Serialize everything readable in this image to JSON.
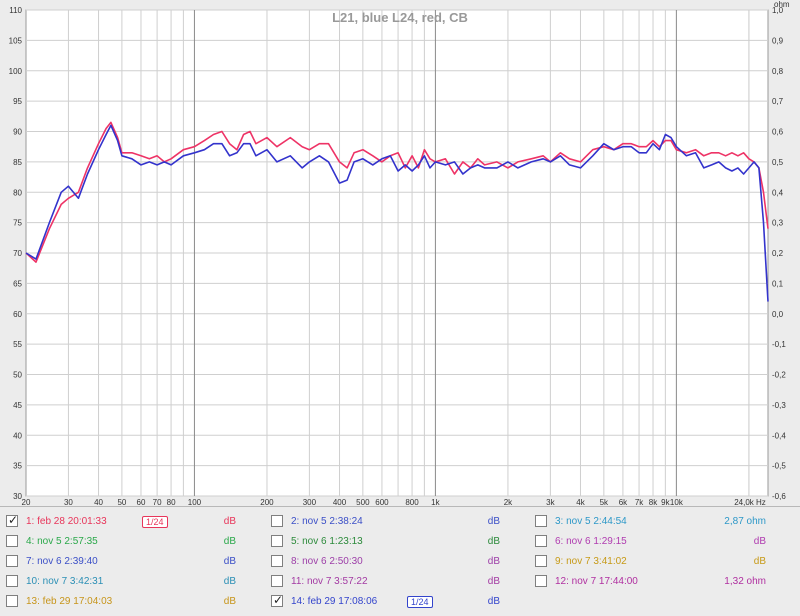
{
  "chart_data": {
    "type": "line",
    "title": "L21, blue L24, red, CB",
    "x_scale": "log",
    "xlim": [
      20,
      24000
    ],
    "ylim": [
      30,
      110
    ],
    "y2lim": [
      -0.6,
      1.0
    ],
    "y2_unit": "ohm",
    "grid": true,
    "y_ticks": [
      30,
      35,
      40,
      45,
      50,
      55,
      60,
      65,
      70,
      75,
      80,
      85,
      90,
      95,
      100,
      105,
      110
    ],
    "y2_ticks": [
      "-0,6",
      "-0,5",
      "-0,4",
      "-0,3",
      "-0,2",
      "-0,1",
      "0,0",
      "0,1",
      "0,2",
      "0,3",
      "0,4",
      "0,5",
      "0,6",
      "0,7",
      "0,8",
      "0,9",
      "1,0"
    ],
    "x_ticks": [
      {
        "v": 20,
        "l": "20"
      },
      {
        "v": 30,
        "l": "30"
      },
      {
        "v": 40,
        "l": "40"
      },
      {
        "v": 50,
        "l": "50"
      },
      {
        "v": 60,
        "l": "60"
      },
      {
        "v": 70,
        "l": "70"
      },
      {
        "v": 80,
        "l": "80"
      },
      {
        "v": 100,
        "l": "100"
      },
      {
        "v": 200,
        "l": "200"
      },
      {
        "v": 300,
        "l": "300"
      },
      {
        "v": 400,
        "l": "400"
      },
      {
        "v": 500,
        "l": "500"
      },
      {
        "v": 600,
        "l": "600"
      },
      {
        "v": 800,
        "l": "800"
      },
      {
        "v": 1000,
        "l": "1k"
      },
      {
        "v": 2000,
        "l": "2k"
      },
      {
        "v": 3000,
        "l": "3k"
      },
      {
        "v": 4000,
        "l": "4k"
      },
      {
        "v": 5000,
        "l": "5k"
      },
      {
        "v": 6000,
        "l": "6k"
      },
      {
        "v": 7000,
        "l": "7k"
      },
      {
        "v": 8000,
        "l": "8k"
      },
      {
        "v": 9000,
        "l": "9k"
      },
      {
        "v": 10000,
        "l": "10k"
      },
      {
        "v": 24000,
        "l": "24,0k Hz"
      }
    ],
    "series": [
      {
        "color": "#ee3366",
        "x": [
          20,
          22,
          25,
          28,
          30,
          33,
          36,
          40,
          43,
          45,
          48,
          50,
          55,
          60,
          65,
          70,
          75,
          80,
          90,
          100,
          110,
          120,
          130,
          140,
          150,
          160,
          170,
          180,
          200,
          220,
          250,
          280,
          300,
          330,
          360,
          400,
          430,
          460,
          500,
          550,
          600,
          650,
          700,
          750,
          800,
          850,
          900,
          950,
          1000,
          1100,
          1200,
          1300,
          1400,
          1500,
          1600,
          1800,
          2000,
          2200,
          2500,
          2800,
          3000,
          3300,
          3600,
          4000,
          4500,
          5000,
          5500,
          6000,
          6500,
          7000,
          7500,
          8000,
          8500,
          9000,
          9500,
          10000,
          11000,
          12000,
          13000,
          14000,
          15000,
          16000,
          17000,
          18000,
          19000,
          20000,
          21000,
          22000,
          23000,
          24000
        ],
        "y": [
          70,
          68.5,
          74,
          78,
          79,
          80,
          84,
          88,
          90.5,
          91.5,
          89,
          86.5,
          86.5,
          86,
          85.5,
          86,
          85,
          85.5,
          87,
          87.5,
          88.5,
          89.5,
          90,
          88,
          87,
          89.5,
          90,
          88,
          89,
          87.5,
          89,
          87.5,
          87,
          88,
          88,
          85,
          84,
          86.5,
          87,
          86,
          85,
          86,
          86.5,
          84,
          86,
          84,
          87,
          85.5,
          85,
          85.5,
          83,
          85,
          84,
          85.5,
          84.5,
          85,
          84,
          85,
          85.5,
          86,
          85,
          86.5,
          85.5,
          85,
          87,
          87.5,
          87,
          88,
          88,
          87.5,
          87.5,
          88.5,
          87.5,
          88.5,
          88.5,
          87,
          86.5,
          87,
          86,
          86.5,
          86.5,
          86,
          86.5,
          86,
          86.5,
          85.5,
          85,
          84,
          80,
          74
        ]
      },
      {
        "color": "#3333cc",
        "x": [
          20,
          22,
          25,
          28,
          30,
          33,
          36,
          40,
          43,
          45,
          48,
          50,
          55,
          60,
          65,
          70,
          75,
          80,
          90,
          100,
          110,
          120,
          130,
          140,
          150,
          160,
          170,
          180,
          200,
          220,
          250,
          280,
          300,
          330,
          360,
          400,
          430,
          460,
          500,
          550,
          600,
          650,
          700,
          750,
          800,
          850,
          900,
          950,
          1000,
          1100,
          1200,
          1300,
          1400,
          1500,
          1600,
          1800,
          2000,
          2200,
          2500,
          2800,
          3000,
          3300,
          3600,
          4000,
          4500,
          5000,
          5500,
          6000,
          6500,
          7000,
          7500,
          8000,
          8500,
          9000,
          9500,
          10000,
          11000,
          12000,
          13000,
          14000,
          15000,
          16000,
          17000,
          18000,
          19000,
          20000,
          21000,
          22000,
          23000,
          24000
        ],
        "y": [
          70,
          69,
          75,
          80,
          81,
          79,
          83,
          87,
          89.5,
          91,
          88.5,
          86,
          85.5,
          84.5,
          85,
          84.5,
          85,
          84.5,
          86,
          86.5,
          87,
          88,
          88,
          86,
          86.5,
          88,
          88,
          86,
          87,
          85,
          86,
          84,
          85,
          86,
          85,
          81.5,
          82,
          85,
          85.5,
          84.5,
          85.5,
          86,
          83.5,
          84.5,
          83.5,
          84.5,
          86,
          84,
          85,
          84.5,
          85,
          83,
          84,
          84.5,
          84,
          84,
          85,
          84,
          85,
          85.5,
          85,
          86,
          84.5,
          84,
          86,
          88,
          87,
          87.5,
          87.5,
          86.5,
          86.5,
          88,
          87,
          89.5,
          89,
          87.5,
          86,
          86.5,
          84,
          84.5,
          85,
          84,
          83.5,
          84,
          83,
          84,
          85,
          84,
          75,
          62
        ]
      }
    ],
    "legend": [
      {
        "label": "1: feb 28 20:01:33",
        "unit": "dB",
        "checked": true,
        "color": "#e8355a",
        "smoothing": "1/24"
      },
      {
        "label": "2: nov 5 2:38:24",
        "unit": "dB",
        "checked": false,
        "color": "#3b4fc7"
      },
      {
        "label": "3: nov 5 2:44:54",
        "unit": "2,87 ohm",
        "checked": false,
        "color": "#2d98c8"
      },
      {
        "label": "4: nov 5 2:57:35",
        "unit": "dB",
        "checked": false,
        "color": "#2aa84a"
      },
      {
        "label": "5: nov 6 1:23:13",
        "unit": "dB",
        "checked": false,
        "color": "#2b8a3a"
      },
      {
        "label": "6: nov 6 1:29:15",
        "unit": "dB",
        "checked": false,
        "color": "#b03cb0"
      },
      {
        "label": "7: nov 6 2:39:40",
        "unit": "dB",
        "checked": false,
        "color": "#3b4fc7"
      },
      {
        "label": "8: nov 6 2:50:30",
        "unit": "dB",
        "checked": false,
        "color": "#9d3ea8"
      },
      {
        "label": "9: nov 7 3:41:02",
        "unit": "dB",
        "checked": false,
        "color": "#c79a17"
      },
      {
        "label": "10: nov 7 3:42:31",
        "unit": "dB",
        "checked": false,
        "color": "#2b8fb5"
      },
      {
        "label": "11: nov 7 3:57:22",
        "unit": "dB",
        "checked": false,
        "color": "#a33aa3"
      },
      {
        "label": "12: nov 7 17:44:00",
        "unit": "1,32 ohm",
        "checked": false,
        "color": "#b02fa0"
      },
      {
        "label": "13: feb 29 17:04:03",
        "unit": "dB",
        "checked": false,
        "color": "#c7951a"
      },
      {
        "label": "14: feb 29 17:08:06",
        "unit": "dB",
        "checked": true,
        "color": "#3344cc",
        "smoothing": "1/24"
      }
    ]
  }
}
